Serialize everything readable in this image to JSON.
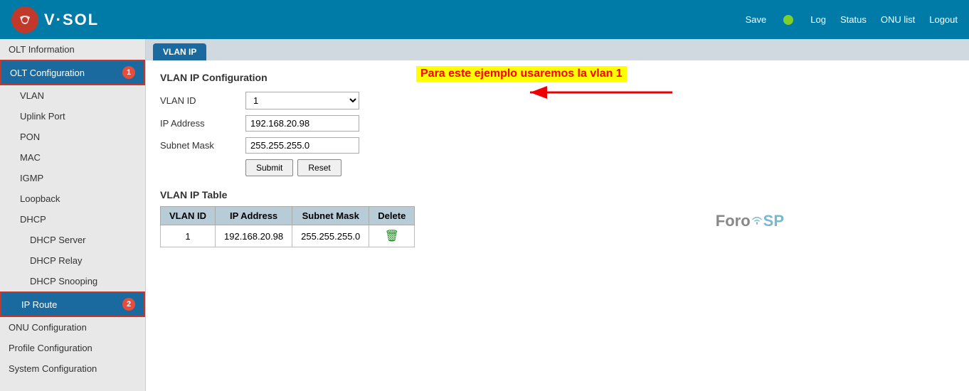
{
  "header": {
    "logo_text": "V·SOL",
    "save_label": "Save",
    "nav_items": [
      "Log",
      "Status",
      "ONU list",
      "Logout"
    ]
  },
  "sidebar": {
    "items": [
      {
        "label": "OLT Information",
        "level": 0,
        "state": "normal",
        "badge": null
      },
      {
        "label": "OLT Configuration",
        "level": 0,
        "state": "highlighted",
        "badge": "1"
      },
      {
        "label": "VLAN",
        "level": 1,
        "state": "normal",
        "badge": null
      },
      {
        "label": "Uplink Port",
        "level": 1,
        "state": "normal",
        "badge": null
      },
      {
        "label": "PON",
        "level": 1,
        "state": "normal",
        "badge": null
      },
      {
        "label": "MAC",
        "level": 1,
        "state": "normal",
        "badge": null
      },
      {
        "label": "IGMP",
        "level": 1,
        "state": "normal",
        "badge": null
      },
      {
        "label": "Loopback",
        "level": 1,
        "state": "normal",
        "badge": null
      },
      {
        "label": "DHCP",
        "level": 1,
        "state": "normal",
        "badge": null
      },
      {
        "label": "DHCP Server",
        "level": 2,
        "state": "normal",
        "badge": null
      },
      {
        "label": "DHCP Relay",
        "level": 2,
        "state": "normal",
        "badge": null
      },
      {
        "label": "DHCP Snooping",
        "level": 2,
        "state": "normal",
        "badge": null
      },
      {
        "label": "IP Route",
        "level": 1,
        "state": "active",
        "badge": "2"
      },
      {
        "label": "ONU Configuration",
        "level": 0,
        "state": "normal",
        "badge": null
      },
      {
        "label": "Profile Configuration",
        "level": 0,
        "state": "normal",
        "badge": null
      },
      {
        "label": "System Configuration",
        "level": 0,
        "state": "normal",
        "badge": null
      }
    ]
  },
  "tab": {
    "label": "VLAN IP"
  },
  "content": {
    "section_title": "VLAN IP Configuration",
    "annotation": "Para este ejemplo usaremos la vlan 1",
    "vlan_id_label": "VLAN ID",
    "ip_address_label": "IP Address",
    "subnet_mask_label": "Subnet Mask",
    "vlan_id_value": "1",
    "ip_address_value": "192.168.20.98",
    "subnet_mask_value": "255.255.255.0",
    "submit_label": "Submit",
    "reset_label": "Reset",
    "table_title": "VLAN IP Table",
    "table_headers": [
      "VLAN ID",
      "IP Address",
      "Subnet Mask",
      "Delete"
    ],
    "table_rows": [
      {
        "vlan_id": "1",
        "ip_address": "192.168.20.98",
        "subnet_mask": "255.255.255.0"
      }
    ]
  }
}
